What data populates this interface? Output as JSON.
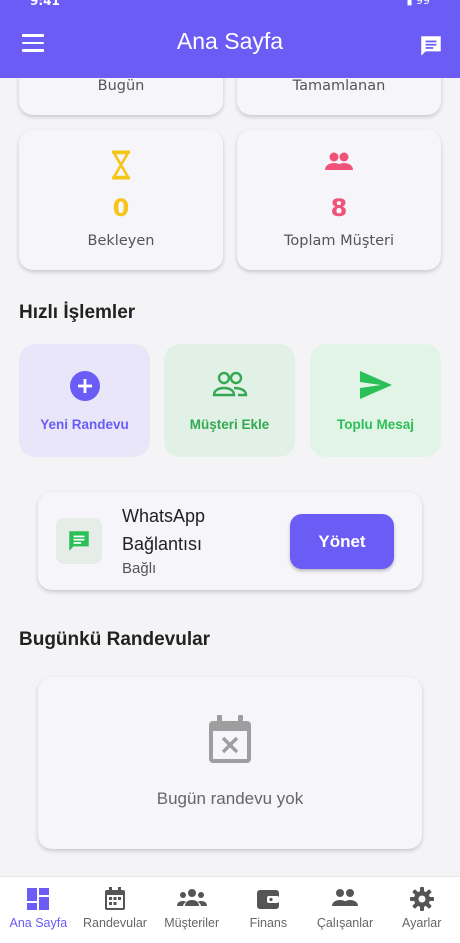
{
  "status_bar": {
    "time": "9:41",
    "battery": "99"
  },
  "app_bar": {
    "title": "Ana Sayfa"
  },
  "stats": {
    "today": {
      "label": "Bugün"
    },
    "completed": {
      "label": "Tamamlanan"
    },
    "pending": {
      "label": "Bekleyen",
      "value": "0",
      "color": "#f5c518"
    },
    "customers": {
      "label": "Toplam Müşteri",
      "value": "8",
      "color": "#f0527a"
    }
  },
  "quick_actions": {
    "title": "Hızlı İşlemler",
    "items": [
      {
        "label": "Yeni Randevu",
        "icon": "plus-circle-icon",
        "color": "#6a5cf5",
        "bg": "#e8e6f8"
      },
      {
        "label": "Müşteri Ekle",
        "icon": "people-outline-icon",
        "color": "#34a853",
        "bg": "#e2f1e5"
      },
      {
        "label": "Toplu Mesaj",
        "icon": "send-icon",
        "color": "#2bbf58",
        "bg": "#e2f4e6"
      }
    ]
  },
  "whatsapp": {
    "title": "WhatsApp Bağlantısı",
    "status": "Bağlı",
    "button": "Yönet"
  },
  "today_appointments": {
    "title": "Bugünkü Randevular",
    "empty_text": "Bugün randevu yok"
  },
  "bottom_nav": {
    "items": [
      {
        "label": "Ana Sayfa",
        "icon": "dashboard-icon",
        "active": true
      },
      {
        "label": "Randevular",
        "icon": "calendar-icon"
      },
      {
        "label": "Müşteriler",
        "icon": "groups-icon"
      },
      {
        "label": "Finans",
        "icon": "wallet-icon"
      },
      {
        "label": "Çalışanlar",
        "icon": "people-icon"
      },
      {
        "label": "Ayarlar",
        "icon": "gear-icon"
      }
    ]
  },
  "colors": {
    "primary": "#6a5cf5",
    "whatsapp_green": "#2bbf58"
  }
}
